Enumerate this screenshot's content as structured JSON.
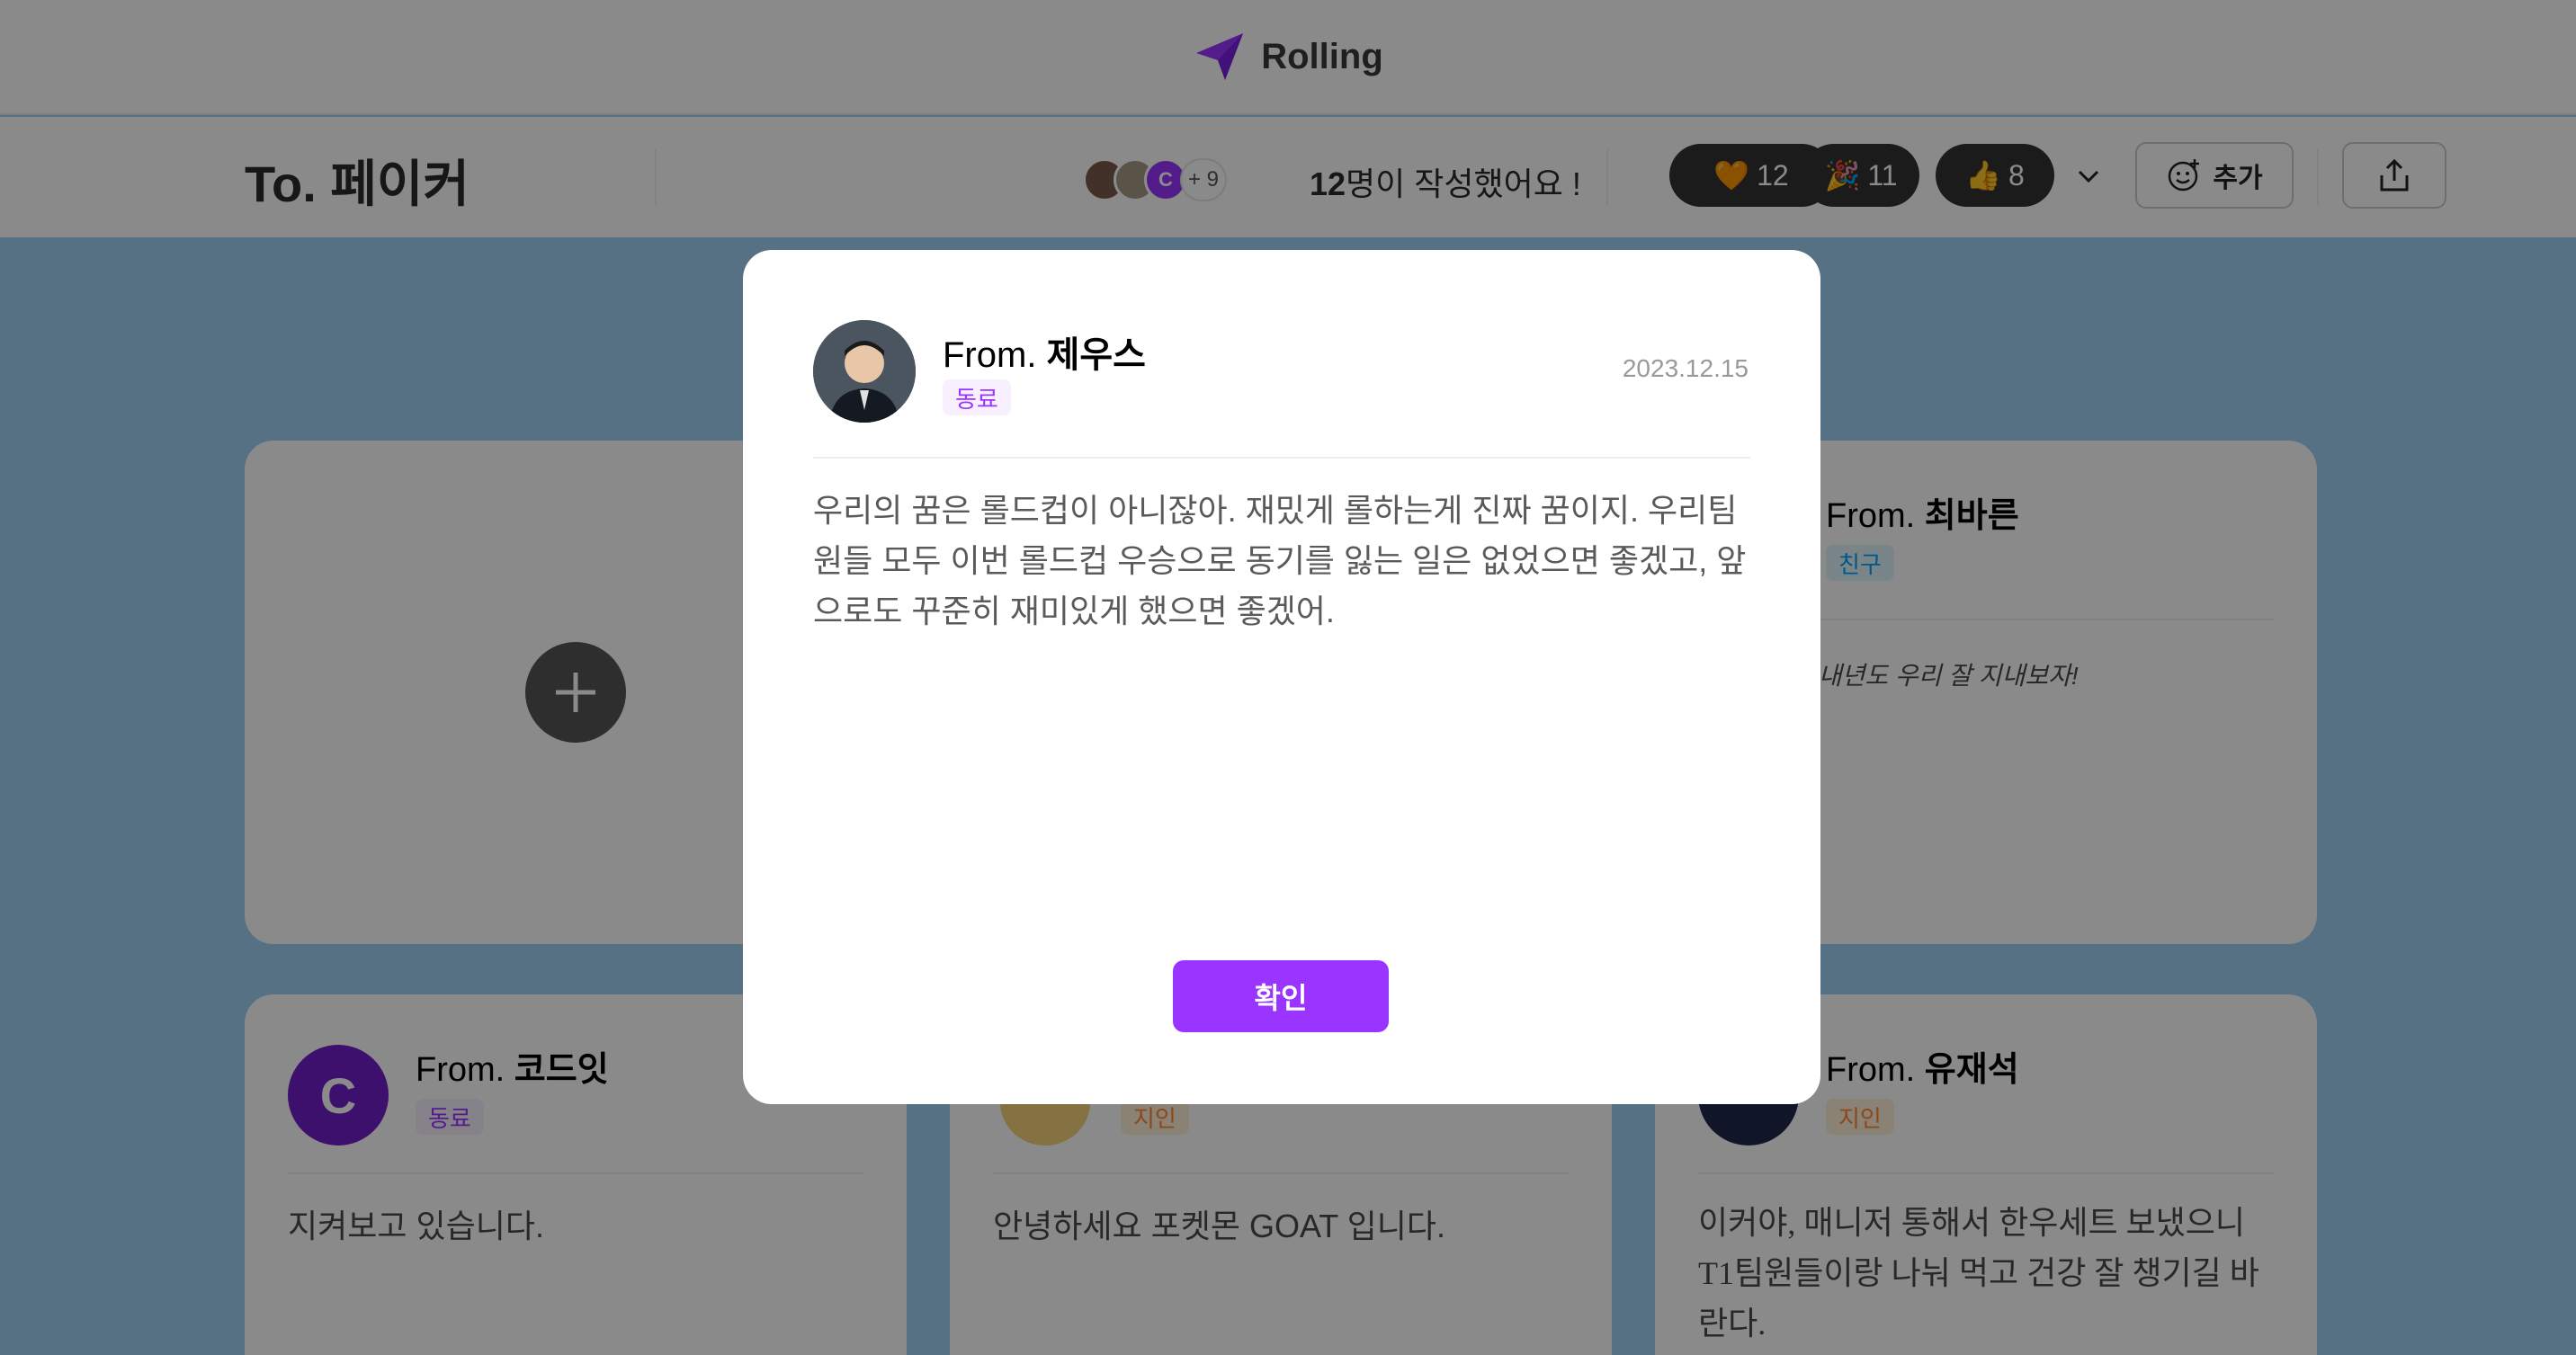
{
  "header": {
    "logo_text": "Rolling"
  },
  "recipient": {
    "title": "To. 페이커"
  },
  "writers": {
    "more": "+ 9",
    "count": "12",
    "count_suffix": "명이 작성했어요 !"
  },
  "reactions": [
    {
      "emoji": "🧡",
      "count": "12"
    },
    {
      "emoji": "🎉",
      "count": "11"
    },
    {
      "emoji": "👍",
      "count": "8"
    }
  ],
  "actions": {
    "add_label": "추가"
  },
  "cards": {
    "top_right": {
      "from_prefix": "From.",
      "name": "최바른",
      "relation": "친구",
      "body": "~! 내년도 우리 잘 지내보자!"
    },
    "bottom_left": {
      "from_prefix": "From.",
      "name": "코드잇",
      "relation": "동료",
      "body": "지켜보고 있습니다."
    },
    "bottom_middle": {
      "relation": "지인",
      "body": "안녕하세요 포켓몬 GOAT 입니다."
    },
    "bottom_right": {
      "from_prefix": "From.",
      "name": "유재석",
      "relation": "지인",
      "body": "이커야, 매니저 통해서 한우세트 보냈으니 T1팀원들이랑 나눠 먹고 건강 잘 챙기길 바란다."
    }
  },
  "modal": {
    "from_prefix": "From.",
    "name": "제우스",
    "relation": "동료",
    "date": "2023.12.15",
    "body": "우리의 꿈은 롤드컵이 아니잖아. 재밌게 롤하는게 진짜 꿈이지. 우리팀원들 모두 이번 롤드컵 우승으로 동기를 잃는 일은 없었으면 좋겠고, 앞으로도 꾸준히 재미있게 했으면 좋겠어.",
    "confirm_label": "확인"
  },
  "colors": {
    "accent": "#9935ff",
    "background": "#9fd0f4",
    "badge": "#333333"
  }
}
